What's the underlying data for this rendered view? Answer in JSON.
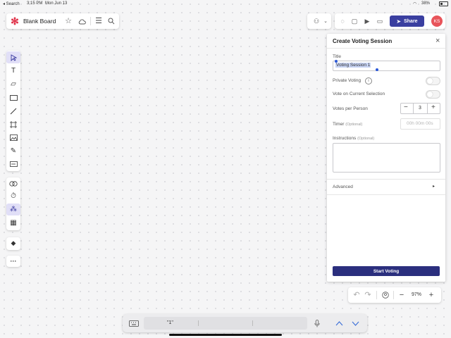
{
  "status_bar": {
    "back": "◂ Search",
    "time": "3:15 PM",
    "date": "Mon Jun 13",
    "battery": "38%"
  },
  "topbar": {
    "logo": "✻",
    "title": "Blank Board",
    "share_label": "Share",
    "avatar_initials": "KS"
  },
  "panel": {
    "header": "Create Voting Session",
    "close": "×",
    "title_label": "Title",
    "title_value": "Voting Session 1",
    "private_label": "Private Voting",
    "info": "i",
    "selection_label": "Vote on Current Selection",
    "votes_label": "Votes per Person",
    "votes_minus": "−",
    "votes_value": "3",
    "votes_plus": "+",
    "timer_label": "Timer",
    "timer_optional": "(Optional)",
    "timer_placeholder": "00h 00m 00s",
    "instructions_label": "Instructions",
    "instructions_optional": "(Optional)",
    "advanced_label": "Advanced",
    "advanced_arrow": "▸",
    "start_label": "Start Voting"
  },
  "zoom": {
    "minus": "−",
    "level": "97%",
    "plus": "+"
  },
  "keyboard_bar": {
    "suggestion": "\"1\""
  },
  "colors": {
    "accent": "#3a3fa0",
    "logo": "#e0334a",
    "avatar": "#e8545a"
  }
}
